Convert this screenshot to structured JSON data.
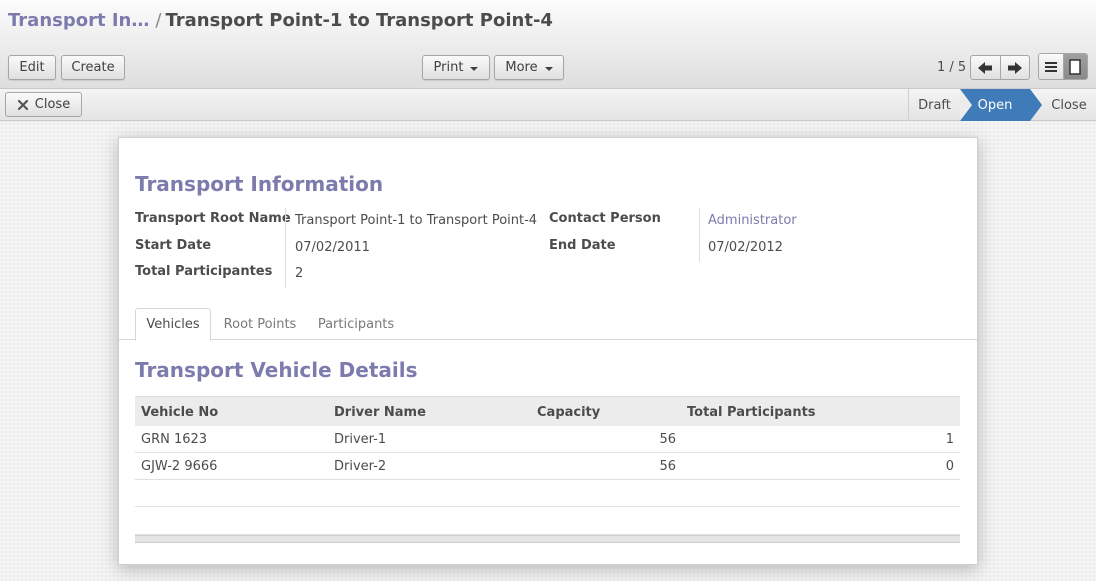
{
  "breadcrumb": {
    "parent": "Transport In…",
    "separator": "/",
    "current": "Transport Point-1 to Transport Point-4"
  },
  "toolbar": {
    "edit_label": "Edit",
    "create_label": "Create",
    "print_label": "Print",
    "more_label": "More",
    "pager": "1 / 5"
  },
  "statusbar": {
    "close_label": "Close",
    "stages": [
      "Draft",
      "Open",
      "Close"
    ],
    "active_stage": "Open"
  },
  "form": {
    "title": "Transport Information",
    "fields": {
      "root_name_label": "Transport Root Name",
      "root_name_value": "Transport Point-1 to Transport Point-4",
      "start_date_label": "Start Date",
      "start_date_value": "07/02/2011",
      "participants_label": "Total Participantes",
      "participants_value": "2",
      "contact_label": "Contact Person",
      "contact_value": "Administrator",
      "end_date_label": "End Date",
      "end_date_value": "07/02/2012"
    },
    "tabs": [
      "Vehicles",
      "Root Points",
      "Participants"
    ],
    "active_tab": "Vehicles",
    "section_title": "Transport Vehicle Details",
    "table": {
      "headers": [
        "Vehicle No",
        "Driver Name",
        "Capacity",
        "Total Participants"
      ],
      "rows": [
        [
          "GRN 1623",
          "Driver-1",
          "56",
          "1"
        ],
        [
          "GJW-2 9666",
          "Driver-2",
          "56",
          "0"
        ]
      ]
    }
  },
  "colors": {
    "accent": "#7c7bad",
    "active_stage": "#3f7ab9"
  }
}
